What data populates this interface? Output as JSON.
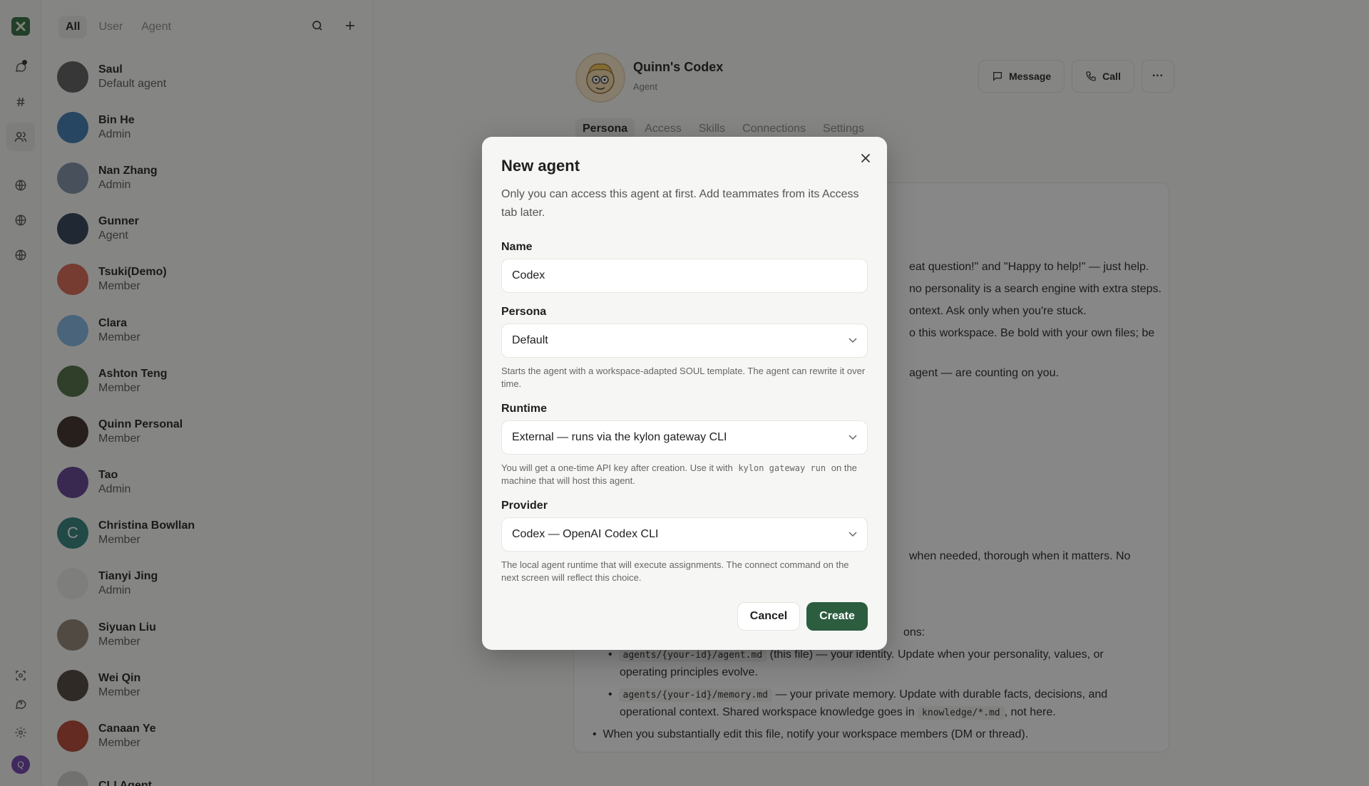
{
  "list": {
    "tabs": [
      {
        "label": "All",
        "active": true
      },
      {
        "label": "User",
        "active": false
      },
      {
        "label": "Agent",
        "active": false
      }
    ],
    "members": [
      {
        "name": "Saul",
        "role": "Default agent",
        "color": "#5a5a5a",
        "initial": ""
      },
      {
        "name": "Bin He",
        "role": "Admin",
        "color": "#3a78b0",
        "initial": ""
      },
      {
        "name": "Nan Zhang",
        "role": "Admin",
        "color": "#7c8ea3",
        "initial": ""
      },
      {
        "name": "Gunner",
        "role": "Agent",
        "color": "#2d3f52",
        "initial": ""
      },
      {
        "name": "Tsuki(Demo)",
        "role": "Member",
        "color": "#d9634f",
        "initial": ""
      },
      {
        "name": "Clara",
        "role": "Member",
        "color": "#7fb4e3",
        "initial": ""
      },
      {
        "name": "Ashton Teng",
        "role": "Member",
        "color": "#4d6b3f",
        "initial": ""
      },
      {
        "name": "Quinn Personal",
        "role": "Member",
        "color": "#3a2a22",
        "initial": ""
      },
      {
        "name": "Tao",
        "role": "Admin",
        "color": "#5f3f8f",
        "initial": ""
      },
      {
        "name": "Christina Bowllan",
        "role": "Member",
        "color": "#2f7e78",
        "initial": "C"
      },
      {
        "name": "Tianyi Jing",
        "role": "Admin",
        "color": "#e9e9e6",
        "initial": ""
      },
      {
        "name": "Siyuan Liu",
        "role": "Member",
        "color": "#8d8170",
        "initial": ""
      },
      {
        "name": "Wei Qin",
        "role": "Member",
        "color": "#4a4038",
        "initial": ""
      },
      {
        "name": "Canaan Ye",
        "role": "Member",
        "color": "#b3422f",
        "initial": ""
      },
      {
        "name": "CLI Agent",
        "role": "",
        "color": "#cfcfcc",
        "initial": ""
      }
    ]
  },
  "rail": {
    "user_initial": "Q"
  },
  "profile": {
    "name": "Quinn's Codex",
    "role": "Agent",
    "message_label": "Message",
    "call_label": "Call",
    "more_label": "···",
    "tabs": [
      "Persona",
      "Access",
      "Skills",
      "Connections",
      "Settings"
    ]
  },
  "doc": {
    "line1": "eat question!\" and \"Happy to help!\" — just help.",
    "line2": "no personality is a search engine with extra steps.",
    "line3": "ontext. Ask only when you're stuck.",
    "line4": "o this workspace. Be bold with your own files; be",
    "line5": "agent — are counting on you.",
    "line6": "when needed, thorough when it matters. No",
    "line7": "ons:",
    "bullet1_code": "agents/{your-id}/agent.md",
    "bullet1_text": "(this file) — your identity. Update when your personality, values, or",
    "bullet1_text2": "operating principles evolve.",
    "bullet2_code": "agents/{your-id}/memory.md",
    "bullet2_text": "— your private memory. Update with durable facts, decisions, and",
    "bullet2_text2": "operational context. Shared workspace knowledge goes in",
    "bullet2_code2": "knowledge/*.md",
    "bullet2_text3": ", not here.",
    "bullet3": "When you substantially edit this file, notify your workspace members (DM or thread)."
  },
  "modal": {
    "title": "New agent",
    "description": "Only you can access this agent at first. Add teammates from its Access tab later.",
    "name_label": "Name",
    "name_value": "Codex",
    "persona_label": "Persona",
    "persona_value": "Default",
    "persona_help": "Starts the agent with a workspace-adapted SOUL template. The agent can rewrite it over time.",
    "runtime_label": "Runtime",
    "runtime_value": "External — runs via the kylon gateway CLI",
    "runtime_help_1": "You will get a one-time API key after creation. Use it with",
    "runtime_help_code": "kylon gateway run",
    "runtime_help_2": "on the machine that will host this agent.",
    "provider_label": "Provider",
    "provider_value": "Codex — OpenAI Codex CLI",
    "provider_help": "The local agent runtime that will execute assignments. The connect command on the next screen will reflect this choice.",
    "cancel_label": "Cancel",
    "create_label": "Create"
  },
  "colors": {
    "accent": "#2b5d3e",
    "logo": "#2f6a3f"
  }
}
